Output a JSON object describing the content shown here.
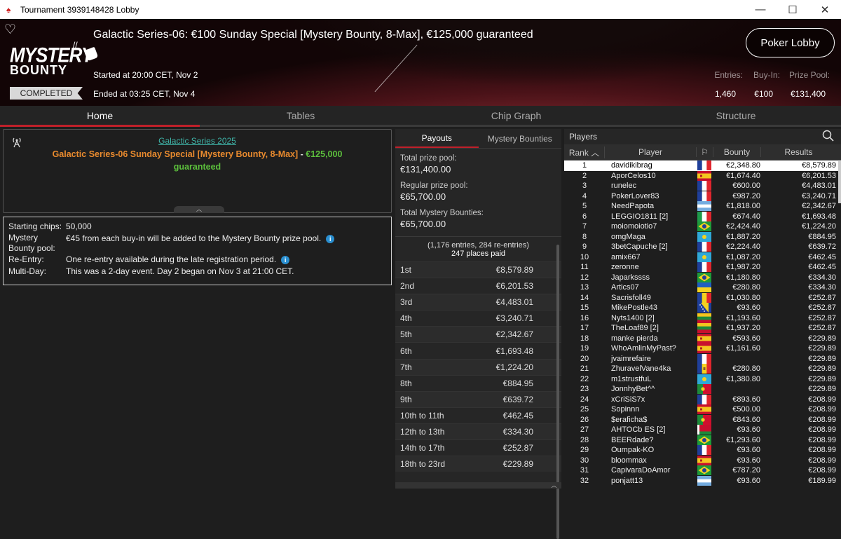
{
  "window": {
    "title": "Tournament 3939148428 Lobby"
  },
  "header": {
    "tournament_title": "Galactic Series-06: €100 Sunday Special [Mystery Bounty, 8-Max], €125,000 guaranteed",
    "logo_line1": "MYSTERY",
    "logo_line2": "BOUNTY",
    "status": "COMPLETED",
    "started": "Started at 20:00 CET, Nov 2",
    "ended": "Ended at 03:25 CET, Nov 4",
    "lobby_button": "Poker Lobby",
    "entries_label": "Entries:",
    "entries_value": "1,460",
    "buyin_label": "Buy-In:",
    "buyin_value": "€100",
    "prize_label": "Prize Pool:",
    "prize_value": "€131,400"
  },
  "tabs": [
    "Home",
    "Tables",
    "Chip Graph",
    "Structure"
  ],
  "info": {
    "series_link": "Galactic Series 2025",
    "series_name": "Galactic Series-06 Sunday Special [Mystery Bounty, 8-Max]",
    "dash": " - ",
    "guarantee": "€125,000 guaranteed"
  },
  "details": [
    {
      "key": "Starting chips:",
      "value": "50,000",
      "info": false
    },
    {
      "key": "Mystery Bounty pool:",
      "value": "€45 from each buy-in will be added to the Mystery Bounty prize pool.",
      "info": true
    },
    {
      "key": "Re-Entry:",
      "value": "One re-entry available during the late registration period.",
      "info": true
    },
    {
      "key": "Multi-Day:",
      "value": "This was a 2-day event. Day 2 began on Nov 3 at 21:00 CET.",
      "info": false
    }
  ],
  "payouts": {
    "tab_payouts": "Payouts",
    "tab_bounties": "Mystery Bounties",
    "total_label": "Total prize pool:",
    "total_value": "€131,400.00",
    "regular_label": "Regular prize pool:",
    "regular_value": "€65,700.00",
    "bounty_label": "Total Mystery Bounties:",
    "bounty_value": "€65,700.00",
    "entries_line": "(1,176 entries, 284 re-entries)",
    "places_paid": "247 places paid",
    "rows": [
      {
        "place": "1st",
        "prize": "€8,579.89"
      },
      {
        "place": "2nd",
        "prize": "€6,201.53"
      },
      {
        "place": "3rd",
        "prize": "€4,483.01"
      },
      {
        "place": "4th",
        "prize": "€3,240.71"
      },
      {
        "place": "5th",
        "prize": "€2,342.67"
      },
      {
        "place": "6th",
        "prize": "€1,693.48"
      },
      {
        "place": "7th",
        "prize": "€1,224.20"
      },
      {
        "place": "8th",
        "prize": "€884.95"
      },
      {
        "place": "9th",
        "prize": "€639.72"
      },
      {
        "place": "10th to 11th",
        "prize": "€462.45"
      },
      {
        "place": "12th to 13th",
        "prize": "€334.30"
      },
      {
        "place": "14th to 17th",
        "prize": "€252.87"
      },
      {
        "place": "18th to 23rd",
        "prize": "€229.89"
      }
    ]
  },
  "players": {
    "title": "Players",
    "col_rank": "Rank",
    "col_player": "Player",
    "col_bounty": "Bounty",
    "col_results": "Results",
    "rows": [
      {
        "rank": "1",
        "name": "davidikibrag",
        "flag": "fr",
        "bounty": "€2,348.80",
        "result": "€8,579.89"
      },
      {
        "rank": "2",
        "name": "AporCelos10",
        "flag": "es",
        "bounty": "€1,674.40",
        "result": "€6,201.53"
      },
      {
        "rank": "3",
        "name": "runelec",
        "flag": "fr",
        "bounty": "€600.00",
        "result": "€4,483.01"
      },
      {
        "rank": "4",
        "name": "PokerLover83",
        "flag": "fr",
        "bounty": "€987.20",
        "result": "€3,240.71"
      },
      {
        "rank": "5",
        "name": "NeedPapota",
        "flag": "ar",
        "bounty": "€1,818.00",
        "result": "€2,342.67"
      },
      {
        "rank": "6",
        "name": "LEGGIO1811 [2]",
        "flag": "it",
        "bounty": "€674.40",
        "result": "€1,693.48"
      },
      {
        "rank": "7",
        "name": "moiomoiotio7",
        "flag": "br",
        "bounty": "€2,424.40",
        "result": "€1,224.20"
      },
      {
        "rank": "8",
        "name": "omgMaga",
        "flag": "kz",
        "bounty": "€1,887.20",
        "result": "€884.95"
      },
      {
        "rank": "9",
        "name": "3betCapuche [2]",
        "flag": "fr",
        "bounty": "€2,224.40",
        "result": "€639.72"
      },
      {
        "rank": "10",
        "name": "amix667",
        "flag": "kz",
        "bounty": "€1,087.20",
        "result": "€462.45"
      },
      {
        "rank": "11",
        "name": "zeronne",
        "flag": "fr",
        "bounty": "€1,987.20",
        "result": "€462.45"
      },
      {
        "rank": "12",
        "name": "Japarkssss",
        "flag": "br",
        "bounty": "€1,180.80",
        "result": "€334.30"
      },
      {
        "rank": "13",
        "name": "Artics07",
        "flag": "ua",
        "bounty": "€280.80",
        "result": "€334.30"
      },
      {
        "rank": "14",
        "name": "Sacrisfoll49",
        "flag": "ro",
        "bounty": "€1,030.80",
        "result": "€252.87"
      },
      {
        "rank": "15",
        "name": "MikePostle43",
        "flag": "ba",
        "bounty": "€93.60",
        "result": "€252.87"
      },
      {
        "rank": "16",
        "name": "Nyts1400 [2]",
        "flag": "lt",
        "bounty": "€1,193.60",
        "result": "€252.87"
      },
      {
        "rank": "17",
        "name": "TheLoaf89 [2]",
        "flag": "lt",
        "bounty": "€1,937.20",
        "result": "€252.87"
      },
      {
        "rank": "18",
        "name": "manke pierda",
        "flag": "es",
        "bounty": "€593.60",
        "result": "€229.89"
      },
      {
        "rank": "19",
        "name": "WhoAmlinMyPast?",
        "flag": "es",
        "bounty": "€1,161.60",
        "result": "€229.89"
      },
      {
        "rank": "20",
        "name": "jvaimrefaire",
        "flag": "fr",
        "bounty": "",
        "result": "€229.89"
      },
      {
        "rank": "21",
        "name": "ZhuravelVane4ka",
        "flag": "md",
        "bounty": "€280.80",
        "result": "€229.89"
      },
      {
        "rank": "22",
        "name": "m1strustfuL",
        "flag": "kz",
        "bounty": "€1,380.80",
        "result": "€229.89"
      },
      {
        "rank": "23",
        "name": "JonnhyBet^^",
        "flag": "pt",
        "bounty": "",
        "result": "€229.89"
      },
      {
        "rank": "24",
        "name": "xCriSiS7x",
        "flag": "fr",
        "bounty": "€893.60",
        "result": "€208.99"
      },
      {
        "rank": "25",
        "name": "Sopinnn",
        "flag": "es",
        "bounty": "€500.00",
        "result": "€208.99"
      },
      {
        "rank": "26",
        "name": "$eraficha$",
        "flag": "pt",
        "bounty": "€843.60",
        "result": "€208.99"
      },
      {
        "rank": "27",
        "name": "AHTOCb ES [2]",
        "flag": "by",
        "bounty": "€93.60",
        "result": "€208.99"
      },
      {
        "rank": "28",
        "name": "BEERdade?",
        "flag": "br",
        "bounty": "€1,293.60",
        "result": "€208.99"
      },
      {
        "rank": "29",
        "name": "Oumpak-KO",
        "flag": "fr",
        "bounty": "€93.60",
        "result": "€208.99"
      },
      {
        "rank": "30",
        "name": "bloommax",
        "flag": "es",
        "bounty": "€93.60",
        "result": "€208.99"
      },
      {
        "rank": "31",
        "name": "CapivaraDoAmor",
        "flag": "br",
        "bounty": "€787.20",
        "result": "€208.99"
      },
      {
        "rank": "32",
        "name": "ponjatt13",
        "flag": "ar",
        "bounty": "€93.60",
        "result": "€189.99"
      }
    ]
  },
  "colors": {
    "accent": "#c0202a",
    "link": "#3fb4a8",
    "orange": "#e88a2e",
    "green": "#5cbf3c"
  },
  "icons": [
    "heart-icon",
    "search-icon",
    "info-icon",
    "antenna-icon",
    "sort-arrow-icon",
    "flag-column-icon"
  ]
}
